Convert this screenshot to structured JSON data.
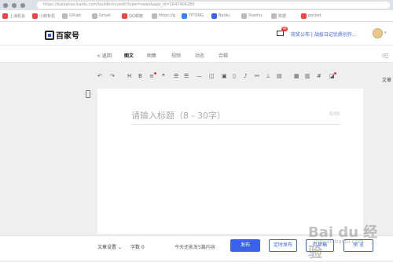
{
  "browser": {
    "url": "https://baijiahao.baidu.com/builder/rc/edit?type=news&app_id=1647406280"
  },
  "bookmarks": [
    {
      "label": "上海机会",
      "color": "#e44"
    },
    {
      "label": "小鹅有机",
      "color": "#e44"
    },
    {
      "label": "Gitlab",
      "color": "#bbb"
    },
    {
      "label": "Gmail",
      "color": "#bbb"
    },
    {
      "label": "QQ邮箱",
      "color": "#e44"
    },
    {
      "label": "https://g",
      "color": "#bbb"
    },
    {
      "label": "YiTONG",
      "color": "#3b82f6"
    },
    {
      "label": "Baidu",
      "color": "#3b62e6"
    },
    {
      "label": "Xiaohu",
      "color": "#bbb"
    },
    {
      "label": "数据",
      "color": "#bbb"
    },
    {
      "label": "pocket",
      "color": "#e44"
    }
  ],
  "header": {
    "logo_text": "百家号",
    "mail_badge": "99",
    "notice": "获奖公布 | 战疫日记优质创作..."
  },
  "subnav": {
    "back": "< 返回",
    "tabs": [
      "图文",
      "图集",
      "视频",
      "动态",
      "合辑"
    ],
    "right_cut": "(已"
  },
  "toolbar": {
    "items": [
      {
        "name": "undo-icon",
        "glyph": "↶"
      },
      {
        "name": "redo-icon",
        "glyph": "↷"
      },
      {
        "name": "heading-icon",
        "glyph": "H"
      },
      {
        "name": "bold-icon",
        "glyph": "B"
      },
      {
        "name": "align-icon",
        "glyph": "≡"
      },
      {
        "name": "quote-icon",
        "glyph": "❝"
      },
      {
        "name": "ordered-list-icon",
        "glyph": "☰"
      },
      {
        "name": "unordered-list-icon",
        "glyph": "☰"
      },
      {
        "name": "divider-icon",
        "glyph": "—"
      },
      {
        "name": "image-icon",
        "glyph": "◫"
      },
      {
        "name": "picture-icon",
        "glyph": "▣"
      },
      {
        "name": "video-icon",
        "glyph": "▯"
      },
      {
        "name": "music-icon",
        "glyph": "♪"
      },
      {
        "name": "link-icon",
        "glyph": "⚯"
      },
      {
        "name": "vote-icon",
        "glyph": "⊥"
      },
      {
        "name": "chart-icon",
        "glyph": "▤"
      },
      {
        "name": "table-icon",
        "glyph": "▦"
      },
      {
        "name": "card-icon",
        "glyph": "▥"
      },
      {
        "name": "hashtag-icon",
        "glyph": "#"
      },
      {
        "name": "widget-icon",
        "glyph": "◪"
      }
    ]
  },
  "side_label": "文章",
  "editor": {
    "title_placeholder": "请输入标题（8 - 30字）",
    "count": "0/30"
  },
  "footer": {
    "settings": "文章设置 ⌄",
    "word_count": "字数 0",
    "remaining": "今天还能发5篇内容",
    "publish": "发布",
    "schedule": "定时发布",
    "draft": "存草稿",
    "preview": "预 览"
  },
  "watermark": {
    "text": "Bai du 经验",
    "sub": "jingyan.baidu.com"
  }
}
